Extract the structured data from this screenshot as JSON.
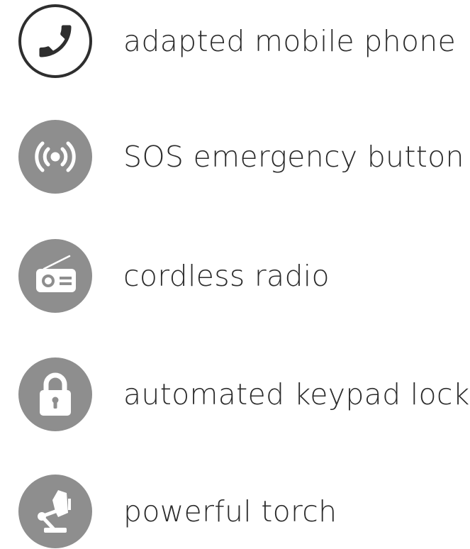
{
  "colors": {
    "badge_fill": "#8e8e8e",
    "badge_outline": "#2e2e2e",
    "icon_fill": "#ffffff",
    "text": "#2b2b2b"
  },
  "features": [
    {
      "icon": "phone-handset-icon",
      "style": "outlined",
      "label": "adapted mobile phone"
    },
    {
      "icon": "sos-broadcast-icon",
      "style": "filled",
      "label": "SOS emergency button"
    },
    {
      "icon": "radio-icon",
      "style": "filled",
      "label": "cordless radio"
    },
    {
      "icon": "padlock-icon",
      "style": "filled",
      "label": "automated keypad lock"
    },
    {
      "icon": "desk-lamp-icon",
      "style": "filled",
      "label": "powerful torch"
    }
  ]
}
